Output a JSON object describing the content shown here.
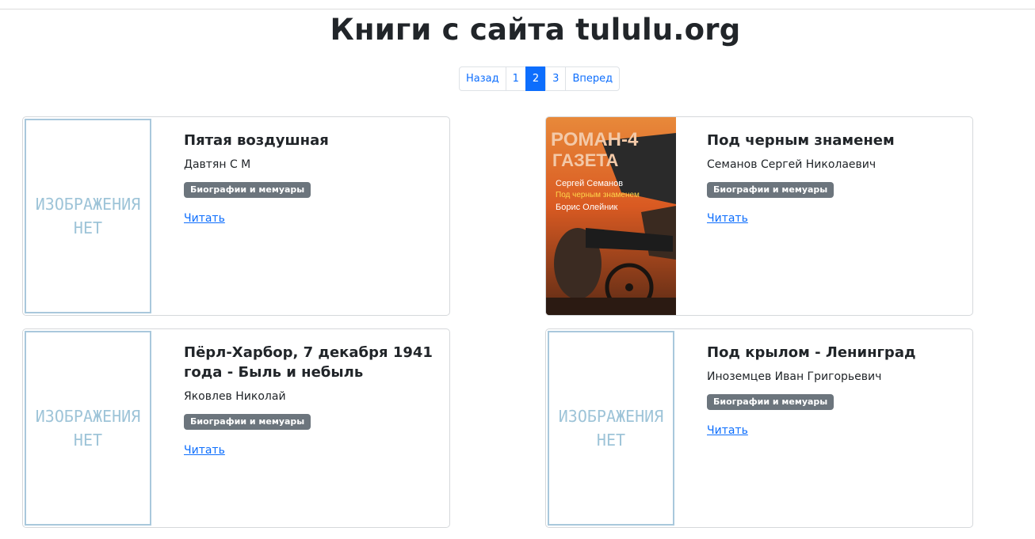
{
  "page": {
    "title": "Книги с сайта tululu.org"
  },
  "pagination": {
    "prev": "Назад",
    "pages": [
      "1",
      "2",
      "3"
    ],
    "active_page": "2",
    "next": "Вперед"
  },
  "books": [
    {
      "title": "Пятая воздушная",
      "author": "Давтян С М",
      "genre": "Биографии и мемуары",
      "read_label": "Читать",
      "cover": "no-image"
    },
    {
      "title": "Под черным знаменем",
      "author": "Семанов Сергей Николаевич",
      "genre": "Биографии и мемуары",
      "read_label": "Читать",
      "cover": "image"
    },
    {
      "title": "Пёрл-Харбор, 7 декабря 1941 года - Быль и небыль",
      "author": "Яковлев Николай",
      "genre": "Биографии и мемуары",
      "read_label": "Читать",
      "cover": "no-image"
    },
    {
      "title": "Под крылом - Ленинград",
      "author": "Иноземцев Иван Григорьевич",
      "genre": "Биографии и мемуары",
      "read_label": "Читать",
      "cover": "no-image"
    }
  ],
  "placeholder": {
    "line1": "ИЗОБРАЖЕНИЯ",
    "line2": "НЕТ"
  },
  "magazine_cover": {
    "masthead_line1": "РОМАН-4",
    "masthead_line2": "ГАЗЕТА",
    "author1": "Сергей Семанов",
    "title_line": "Под черным знаменем",
    "author2": "Борис Олейник"
  },
  "colors": {
    "accent": "#0d6efd",
    "badge": "#6c757d",
    "placeholder": "#9ec4d8"
  }
}
